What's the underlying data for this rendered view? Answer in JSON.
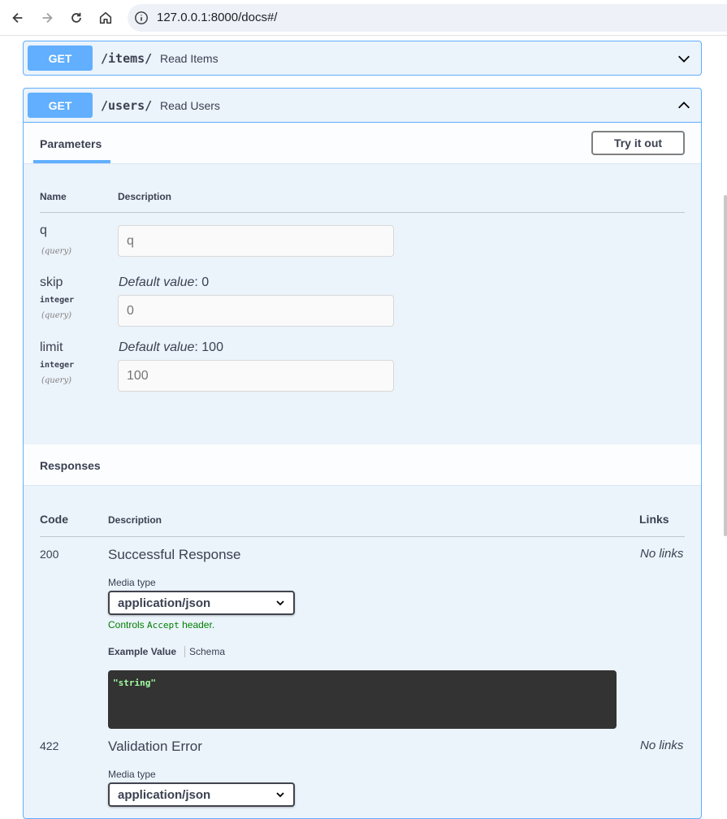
{
  "browser": {
    "url": "127.0.0.1:8000/docs#/"
  },
  "ops": [
    {
      "method": "GET",
      "path": "/items/",
      "summary": "Read Items"
    },
    {
      "method": "GET",
      "path": "/users/",
      "summary": "Read Users"
    }
  ],
  "parameters": {
    "tab_label": "Parameters",
    "try_button": "Try it out",
    "col_name": "Name",
    "col_description": "Description",
    "items": [
      {
        "name": "q",
        "type": "",
        "in": "(query)",
        "default_label": "",
        "default_value": "",
        "placeholder": "q"
      },
      {
        "name": "skip",
        "type": "integer",
        "in": "(query)",
        "default_label": "Default value",
        "default_value": ": 0",
        "placeholder": "0"
      },
      {
        "name": "limit",
        "type": "integer",
        "in": "(query)",
        "default_label": "Default value",
        "default_value": ": 100",
        "placeholder": "100"
      }
    ]
  },
  "responses": {
    "label": "Responses",
    "col_code": "Code",
    "col_description": "Description",
    "col_links": "Links",
    "items": [
      {
        "code": "200",
        "description": "Successful Response",
        "links": "No links",
        "media_type_label": "Media type",
        "media_type": "application/json",
        "controls_prefix": "Controls ",
        "controls_code": "Accept",
        "controls_suffix": " header.",
        "example_tab": "Example Value",
        "schema_tab": "Schema",
        "example": "\"string\""
      },
      {
        "code": "422",
        "description": "Validation Error",
        "links": "No links",
        "media_type_label": "Media type",
        "media_type": "application/json"
      }
    ]
  }
}
